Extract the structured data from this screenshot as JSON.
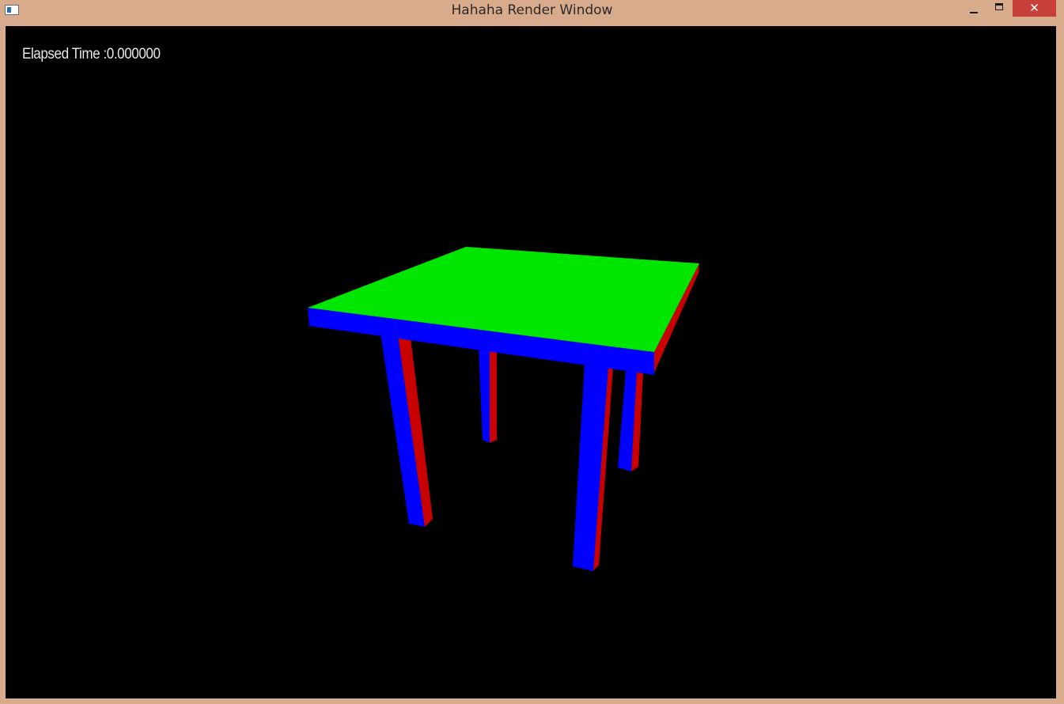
{
  "window": {
    "title": "Hahaha Render Window",
    "close_glyph": "✕"
  },
  "hud": {
    "elapsed_label": "Elapsed Time :",
    "elapsed_value": "0.000000"
  },
  "scene": {
    "object": "table",
    "background_color": "#000000",
    "colors": {
      "top": "#00e600",
      "front": "#0000ff",
      "side": "#c80000"
    }
  }
}
